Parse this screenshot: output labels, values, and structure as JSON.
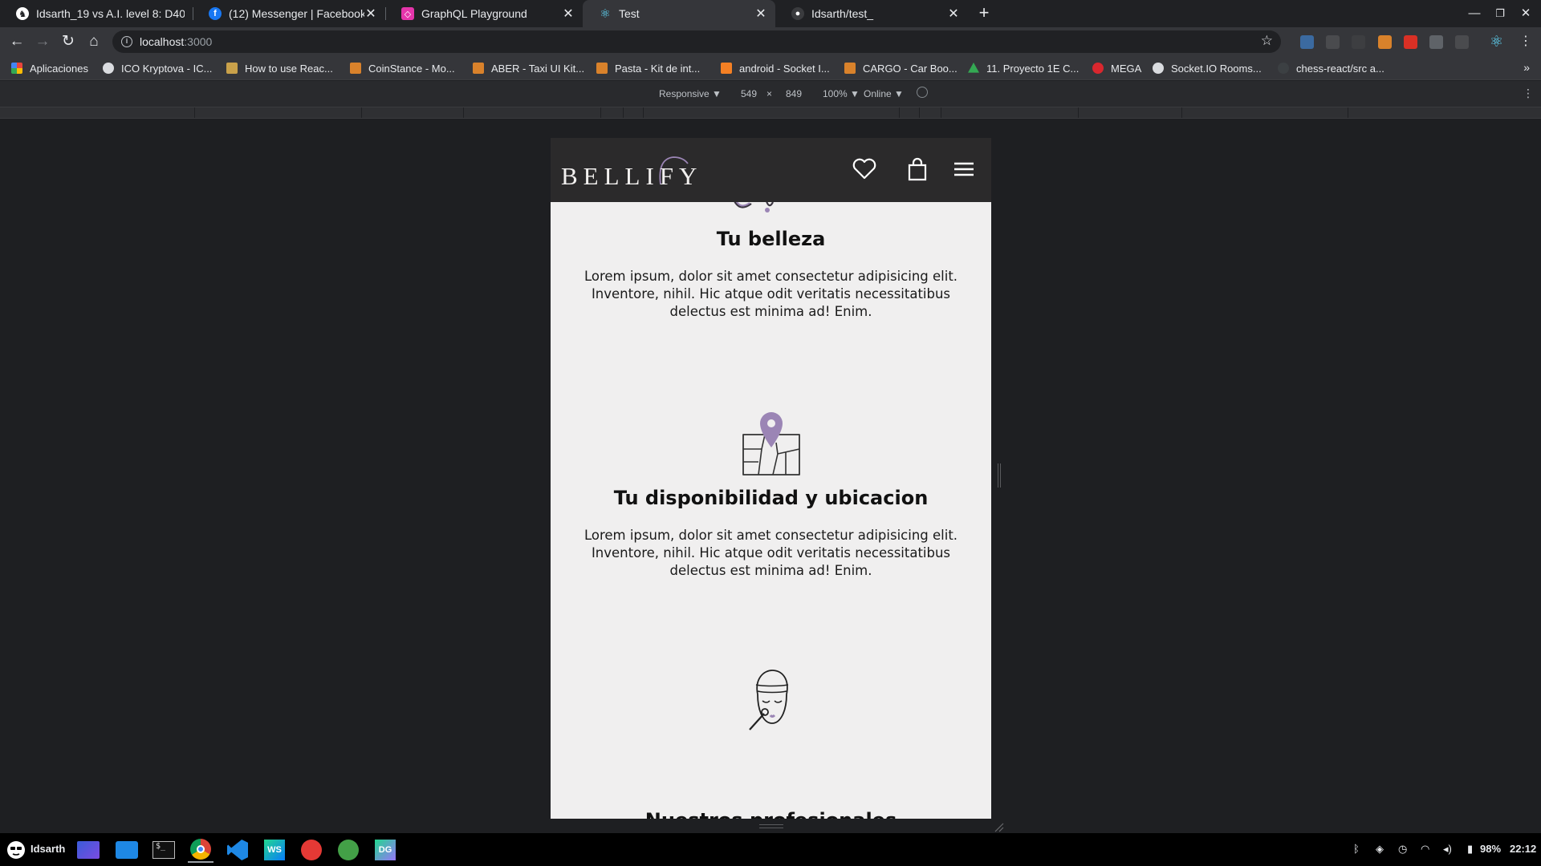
{
  "browser": {
    "tabs": [
      {
        "title": "Idsarth_19 vs A.I. level 8: D40",
        "favicon_color": "#ffffff",
        "active": false
      },
      {
        "title": "(12) Messenger | Facebook",
        "favicon_color": "#1877f2",
        "active": false
      },
      {
        "title": "GraphQL Playground",
        "favicon_color": "#e535ab",
        "active": false
      },
      {
        "title": "Test",
        "favicon_color": "#61dafb",
        "active": true
      },
      {
        "title": "Idsarth/test_",
        "favicon_color": "#6e7681",
        "active": false
      }
    ],
    "new_tab_label": "+",
    "address": {
      "host": "localhost",
      "port": ":3000"
    },
    "bookmarks": [
      {
        "label": "Aplicaciones",
        "color": "#e8453c"
      },
      {
        "label": "ICO Kryptova - IC...",
        "color": "#dadce0"
      },
      {
        "label": "How to use Reac...",
        "color": "#c9a14a"
      },
      {
        "label": "CoinStance - Mo...",
        "color": "#d9822b"
      },
      {
        "label": "ABER - Taxi UI Kit...",
        "color": "#d9822b"
      },
      {
        "label": "Pasta - Kit de int...",
        "color": "#d9822b"
      },
      {
        "label": "android - Socket I...",
        "color": "#f48024"
      },
      {
        "label": "CARGO - Car Boo...",
        "color": "#d9822b"
      },
      {
        "label": "11. Proyecto 1E C...",
        "color": "#34a853"
      },
      {
        "label": "MEGA",
        "color": "#d9272e"
      },
      {
        "label": "Socket.IO Rooms...",
        "color": "#dadce0"
      },
      {
        "label": "chess-react/src a...",
        "color": "#3c4043"
      }
    ],
    "bookmarks_more": "»"
  },
  "devtools": {
    "device_mode": "Responsive ▼",
    "width": "549",
    "times": "×",
    "height": "849",
    "zoom": "100% ▼",
    "network": "Online ▼",
    "kebab": "⋮"
  },
  "site": {
    "logo": "BELLIFY",
    "sections": [
      {
        "title": "Tu belleza",
        "text": "Lorem ipsum, dolor sit amet consectetur adipisicing elit. Inventore, nihil. Hic atque odit veritatis necessitatibus delectus est minima ad! Enim."
      },
      {
        "title": "Tu disponibilidad y ubicacion",
        "text": "Lorem ipsum, dolor sit amet consectetur adipisicing elit. Inventore, nihil. Hic atque odit veritatis necessitatibus delectus est minima ad! Enim."
      },
      {
        "title": "Nuestros profesionales",
        "text": ""
      }
    ],
    "accent_color": "#9b85b5"
  },
  "taskbar": {
    "user": "Idsarth",
    "battery": "98%",
    "clock": "22:12"
  }
}
